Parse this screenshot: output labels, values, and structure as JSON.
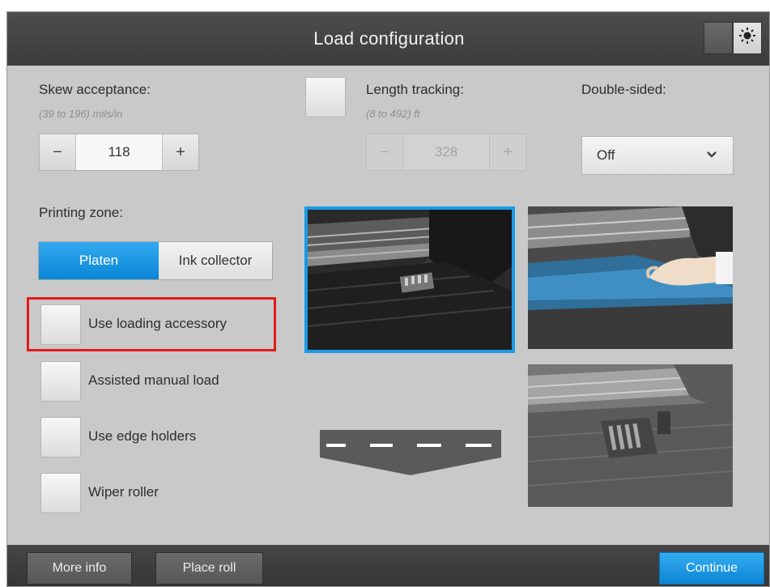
{
  "window": {
    "title": "Load configuration"
  },
  "skew": {
    "label": "Skew acceptance:",
    "range": "(39 to 196) mils/in",
    "value": "118",
    "minus": "−",
    "plus": "+"
  },
  "length_tracking": {
    "label": "Length tracking:",
    "range": "(8 to 492) ft",
    "value": "328",
    "minus": "−",
    "plus": "+",
    "checked": false,
    "enabled": false
  },
  "double_sided": {
    "label": "Double-sided:",
    "value": "Off"
  },
  "printing_zone": {
    "label": "Printing zone:",
    "options": [
      "Platen",
      "Ink collector"
    ],
    "selected": "Platen"
  },
  "options": [
    {
      "label": "Use loading accessory",
      "checked": false
    },
    {
      "label": "Assisted manual load",
      "checked": false
    },
    {
      "label": "Use edge holders",
      "checked": false
    },
    {
      "label": "Wiper roller",
      "checked": false
    }
  ],
  "footer": {
    "more_info": "More info",
    "place_roll": "Place roll",
    "continue": "Continue"
  },
  "colors": {
    "accent": "#1B9AE6",
    "highlight": "#E21A1A",
    "titlebar": "#404040",
    "panel": "#C9C9C9"
  },
  "icons": {
    "brightness": "sun-icon",
    "dropdown": "chevron-down-icon"
  }
}
